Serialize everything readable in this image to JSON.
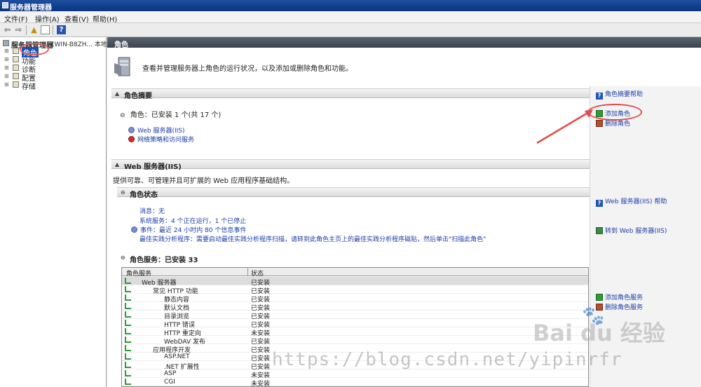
{
  "window": {
    "title": "服务器管理器"
  },
  "menu": [
    "文件(F)",
    "操作(A)",
    "查看(V)",
    "帮助(H)"
  ],
  "tree": {
    "root_label": "服务器管理器",
    "root_sub": "(WIN-B8ZH... 本地)",
    "items": [
      {
        "label": "角色",
        "selected": true
      },
      {
        "label": "功能"
      },
      {
        "label": "诊断"
      },
      {
        "label": "配置"
      },
      {
        "label": "存储"
      }
    ]
  },
  "main": {
    "header": "角色",
    "intro": "查看并管理服务器上角色的运行状况，以及添加或删除角色和功能。",
    "roles_summary": {
      "title": "角色摘要",
      "help_link": "角色摘要帮助",
      "roles_count": "角色：已安装 1 个(共 17 个)",
      "role_items": [
        {
          "label": "Web 服务器(IIS)",
          "type": "web"
        },
        {
          "label": "网络策略和访问服务",
          "type": "error"
        }
      ],
      "actions": [
        "添加角色",
        "删除角色"
      ]
    },
    "web_server": {
      "title": "Web 服务器(IIS)",
      "help_link": "Web 服务器(IIS) 帮助",
      "description": "提供可靠、可管理并且可扩展的 Web 应用程序基础结构。",
      "role_status": {
        "title": "角色状态",
        "link": "转到 Web 服务器(IIS)",
        "lines": [
          "消息：无",
          "系统服务：4 个正在运行，1 个已停止",
          "事件：最近 24 小时内 80 个信息事件",
          "最佳实践分析程序：需要启动最佳实践分析程序扫描，请转到此角色主页上的最佳实践分析程序磁贴，然后单击\"扫描此角色\""
        ]
      },
      "role_services": {
        "title": "角色服务：已安装 33",
        "actions": [
          "添加角色服务",
          "删除角色服务"
        ],
        "columns": [
          "角色服务",
          "状态"
        ],
        "rows": [
          {
            "name": "Web 服务器",
            "status": "已安装",
            "level": 0
          },
          {
            "name": "常见 HTTP 功能",
            "status": "已安装",
            "level": 1
          },
          {
            "name": "静态内容",
            "status": "已安装",
            "level": 2
          },
          {
            "name": "默认文档",
            "status": "已安装",
            "level": 2
          },
          {
            "name": "目录浏览",
            "status": "已安装",
            "level": 2
          },
          {
            "name": "HTTP 错误",
            "status": "已安装",
            "level": 2
          },
          {
            "name": "HTTP 重定向",
            "status": "未安装",
            "level": 2
          },
          {
            "name": "WebDAV 发布",
            "status": "已安装",
            "level": 2
          },
          {
            "name": "应用程序开发",
            "status": "已安装",
            "level": 1
          },
          {
            "name": "ASP.NET",
            "status": "已安装",
            "level": 2
          },
          {
            "name": ".NET 扩展性",
            "status": "已安装",
            "level": 2
          },
          {
            "name": "ASP",
            "status": "未安装",
            "level": 2
          },
          {
            "name": "CGI",
            "status": "未安装",
            "level": 2
          }
        ]
      }
    }
  },
  "watermark": {
    "url": "https://blog.csdn.net/yipinrfr",
    "logo": "Bai du 经验"
  }
}
